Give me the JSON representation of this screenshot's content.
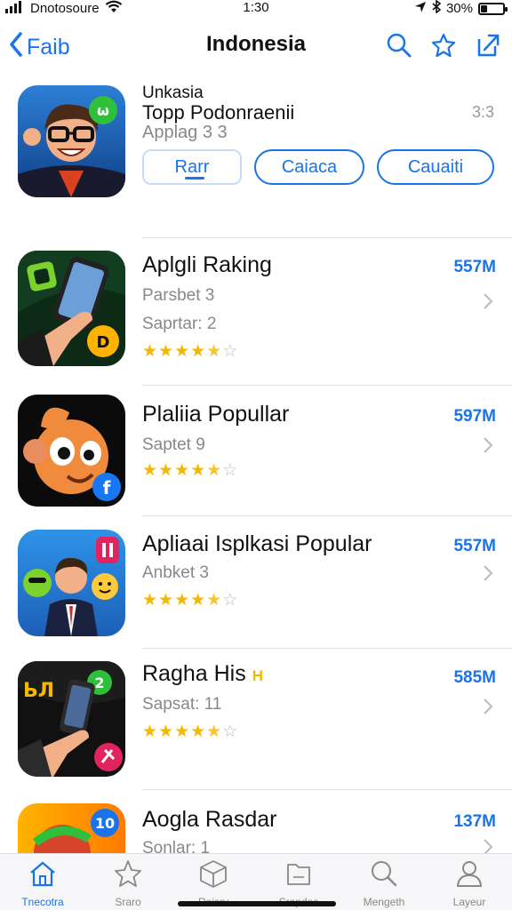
{
  "status_bar": {
    "carrier": "Dnotosoure",
    "time": "1:30",
    "battery": "30%",
    "battery_level": 0.3
  },
  "nav": {
    "back_label": "Faib",
    "title": "Indonesia"
  },
  "featured": {
    "top_label": "Unkasia",
    "subtitle": "Topp Podonraenii",
    "meta": "Applag 3 3",
    "rank": "3:3",
    "buttons": [
      "Rarr",
      "Caiaca",
      "Cauaiti"
    ]
  },
  "apps": [
    {
      "title": "Aplgli Raking",
      "line1": "Parsbet 3",
      "line2": "Saprtar: 2",
      "size": "557M",
      "rating": 4.5
    },
    {
      "title": "Plaliia Popullar",
      "line1": "Saptet 9",
      "size": "597M",
      "rating": 4.5
    },
    {
      "title": "Apliaai Isplkasi Popular",
      "line1": "Anbket 3",
      "size": "557M",
      "rating": 4.5
    },
    {
      "title": "Ragha His",
      "title_badge": "H",
      "line1": "Sapsat: 11",
      "size": "585M",
      "rating": 4.5
    },
    {
      "title": "Aogla Rasdar",
      "line1": "Sonlar: 1",
      "size": "137M"
    }
  ],
  "tabs": [
    {
      "label": "Tnecotra",
      "icon": "home-icon"
    },
    {
      "label": "Sraro",
      "icon": "star-icon"
    },
    {
      "label": "Roisrv",
      "icon": "box-icon"
    },
    {
      "label": "Sropdos",
      "icon": "folder-icon"
    },
    {
      "label": "Mengeth",
      "icon": "search-icon"
    },
    {
      "label": "Layeur",
      "icon": "person-icon"
    }
  ],
  "colors": {
    "accent": "#1a73e8",
    "star": "#f5b800",
    "secondary_text": "#888888"
  }
}
